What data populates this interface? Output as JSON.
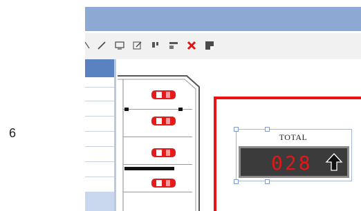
{
  "step": {
    "number": "6"
  },
  "toolbar": {
    "icons": [
      "zoom-icon",
      "pencil-icon",
      "monitor-icon",
      "edit-icon",
      "align-icon",
      "layout-icon",
      "delete-icon",
      "save-icon"
    ]
  },
  "counter": {
    "label": "TOTAL",
    "value": "028",
    "direction": "up-arrow-icon",
    "digit_color": "#e01818",
    "frame_color": "#ee1111"
  },
  "colors": {
    "titlebar": "#8ca8d3",
    "panel_header": "#5a82c0",
    "car": "#e41b1b"
  }
}
